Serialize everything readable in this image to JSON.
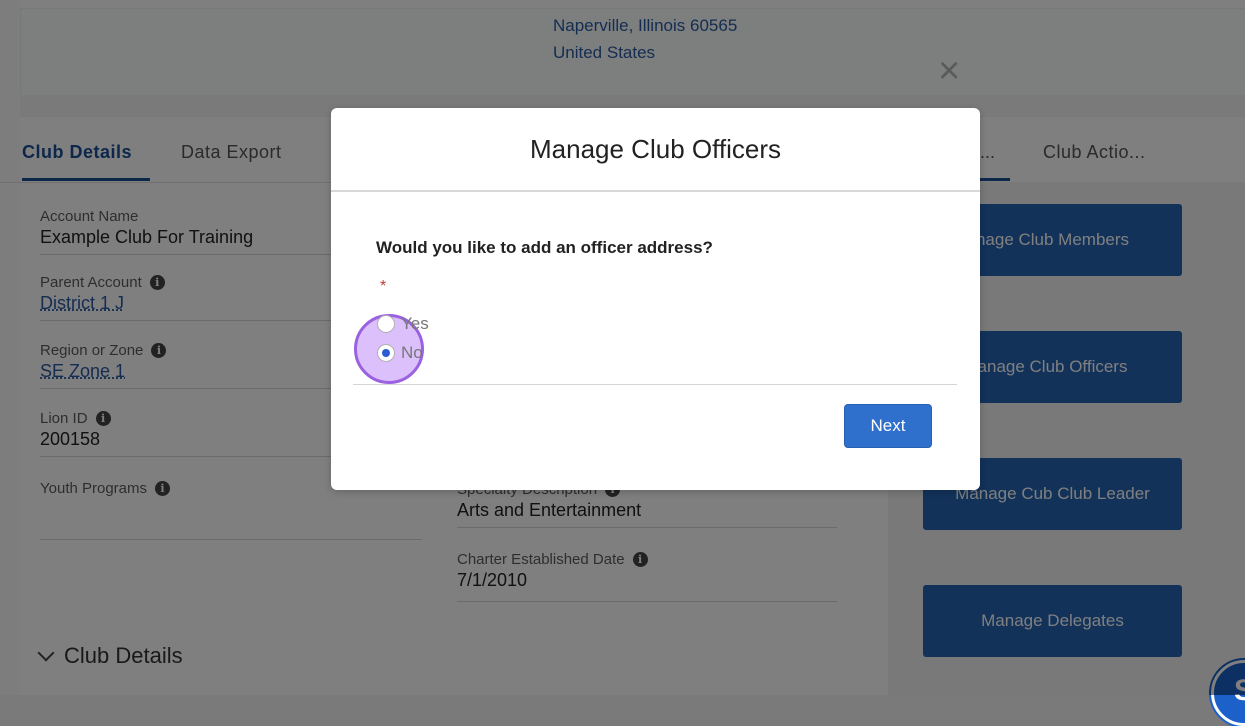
{
  "header": {
    "address_line1": "Naperville, Illinois 60565",
    "address_line2": "United States",
    "close_symbol": "×"
  },
  "tabs": [
    {
      "label": "Club Details",
      "active": true
    },
    {
      "label": "Data Export",
      "active": false
    }
  ],
  "right_tabs": [
    {
      "label": "...",
      "active": true
    },
    {
      "label": "Club Actio...",
      "active": false
    }
  ],
  "fields_left": [
    {
      "label": "Account Name",
      "value": "Example Club For Training",
      "info": false,
      "link": false
    },
    {
      "label": "Parent Account",
      "value": "District 1 J",
      "info": true,
      "link": true
    },
    {
      "label": "Region or Zone",
      "value": "SE Zone 1",
      "info": true,
      "link": true
    },
    {
      "label": "Lion ID",
      "value": "200158",
      "info": true,
      "link": false
    },
    {
      "label": "Youth Programs",
      "value": "",
      "info": true,
      "link": false
    }
  ],
  "fields_mid": [
    {
      "label": "Specialty Description",
      "value": "Arts and Entertainment",
      "info": true
    },
    {
      "label": "Charter Established Date",
      "value": "7/1/2010",
      "info": true
    }
  ],
  "actions": [
    {
      "label": "nage Club Members"
    },
    {
      "label": "anage Club Officers"
    },
    {
      "label": "Manage Cub Club Leader"
    },
    {
      "label": "Manage Delegates"
    }
  ],
  "section": {
    "title": "Club Details"
  },
  "modal": {
    "title": "Manage Club Officers",
    "question": "Would you like to add an officer address?",
    "required_marker": "*",
    "options": [
      {
        "label": "Yes",
        "checked": false
      },
      {
        "label": "No",
        "checked": true
      }
    ],
    "next_label": "Next"
  },
  "info_glyph": "i",
  "fab_glyph": "S"
}
